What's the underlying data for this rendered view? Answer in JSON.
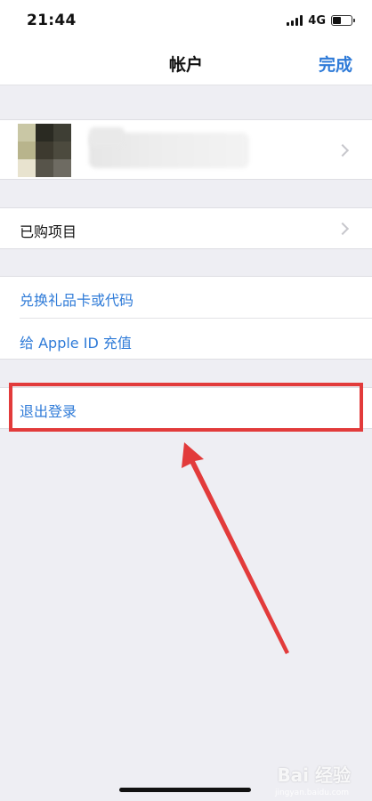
{
  "status": {
    "time": "21:44",
    "network": "4G",
    "battery_level": 0.45
  },
  "nav": {
    "title": "帐户",
    "done_label": "完成"
  },
  "colors": {
    "accent": "#2f7bd8",
    "highlight": "#e23b3b",
    "background": "#eeeef3"
  },
  "profile": {
    "avatar_pixels": [
      "#c9c7a5",
      "#2a2a22",
      "#3e3e34",
      "#b8b48c",
      "#3d3a2f",
      "#4c4a3e",
      "#e8e3cf",
      "#57544a",
      "#6e6b62"
    ]
  },
  "rows": {
    "purchased_label": "已购项目",
    "redeem_label": "兑换礼品卡或代码",
    "add_funds_label": "给 Apple ID 充值",
    "sign_out_label": "退出登录"
  },
  "watermark": {
    "text": "Bai 经验",
    "subtext": "jingyan.baidu.com"
  }
}
